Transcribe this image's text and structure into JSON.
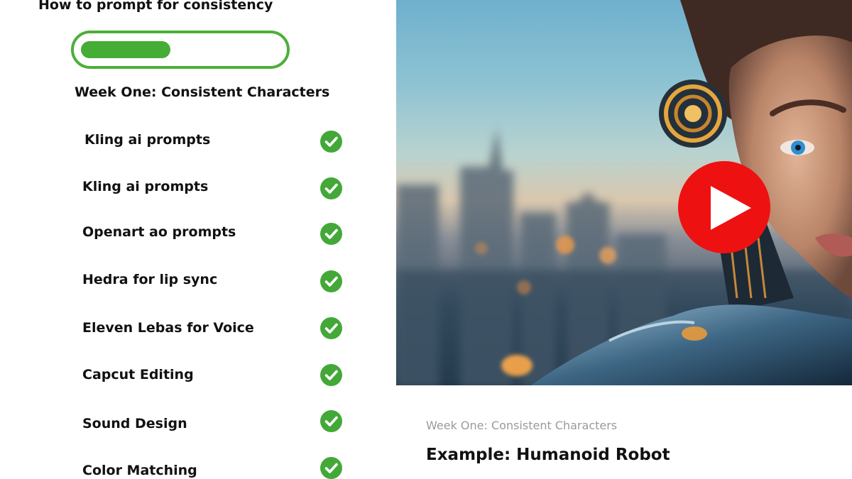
{
  "course": {
    "title": "How to prompt for consistency",
    "progress_fraction": 0.45,
    "accent_color": "#45ad35"
  },
  "week": {
    "heading": "Week One: Consistent Characters"
  },
  "lessons": [
    {
      "label": "Kling ai prompts",
      "completed": true,
      "icon": "check-circle-icon"
    },
    {
      "label": "Kling ai prompts",
      "completed": true,
      "icon": "check-circle-icon"
    },
    {
      "label": "Openart ao prompts",
      "completed": true,
      "icon": "check-circle-icon"
    },
    {
      "label": "Hedra for lip sync",
      "completed": true,
      "icon": "check-circle-icon"
    },
    {
      "label": "Eleven Lebas for Voice",
      "completed": true,
      "icon": "check-circle-icon"
    },
    {
      "label": "Capcut Editing",
      "completed": true,
      "icon": "check-circle-icon"
    },
    {
      "label": "Sound Design",
      "completed": true,
      "icon": "check-circle-icon"
    },
    {
      "label": "Color Matching",
      "completed": true,
      "icon": "check-circle-icon"
    }
  ],
  "video": {
    "play_icon": "play-icon",
    "play_color": "#ee1111",
    "subtitle": "Week One: Consistent Characters",
    "title": "Example: Humanoid Robot"
  }
}
